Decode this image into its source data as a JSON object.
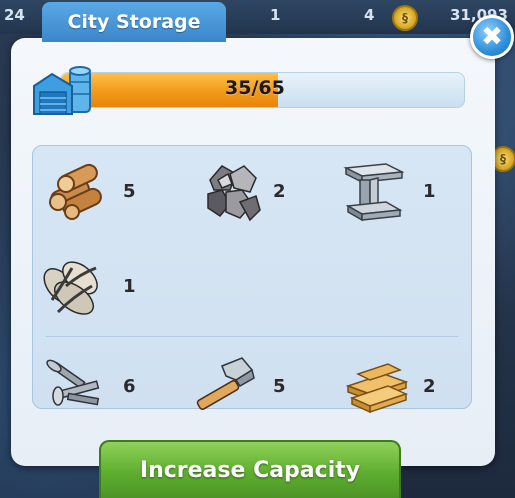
{
  "hud": {
    "left_value": "24",
    "mid_value": "1",
    "right_small": "4",
    "coins": "31,093"
  },
  "window": {
    "title": "City Storage",
    "close_label": "✖"
  },
  "storage": {
    "current": 35,
    "capacity": 65,
    "label": "35/65",
    "fill_fraction": 0.538
  },
  "items": [
    {
      "name": "Wood",
      "icon": "wood-logs-icon",
      "qty": "5"
    },
    {
      "name": "Minerals",
      "icon": "minerals-icon",
      "qty": "2"
    },
    {
      "name": "Metal",
      "icon": "metal-beam-icon",
      "qty": "1"
    },
    {
      "name": "Seeds",
      "icon": "seeds-icon",
      "qty": "1"
    },
    {
      "name": "Nails",
      "icon": "nails-icon",
      "qty": "6"
    },
    {
      "name": "Hammer",
      "icon": "hammer-icon",
      "qty": "5"
    },
    {
      "name": "Planks",
      "icon": "planks-icon",
      "qty": "2"
    }
  ],
  "actions": {
    "increase_label": "Increase Capacity"
  },
  "colors": {
    "panel": "#eef4fa",
    "title_tab": "#3b86c9",
    "progress_fill": "#f29a1a",
    "button_green": "#5fae2f"
  }
}
